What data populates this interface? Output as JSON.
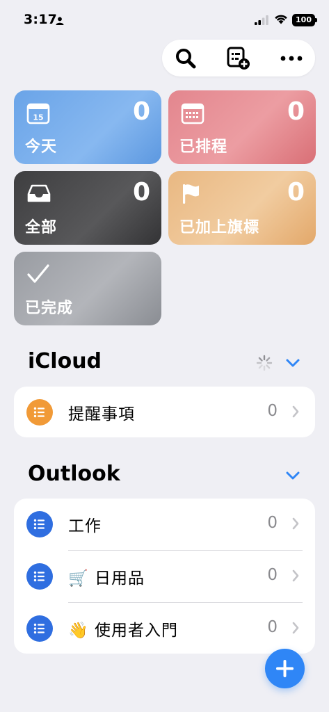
{
  "status_bar": {
    "time": "3:17",
    "battery": "100",
    "icons": [
      "person-icon",
      "signal-icon",
      "wifi-icon",
      "battery-icon"
    ]
  },
  "toolbar": {
    "icons": [
      "search-icon",
      "add-filter-list-icon",
      "more-icon"
    ]
  },
  "smart_lists": [
    {
      "label": "今天",
      "count": "0",
      "icon": "calendar-today-icon",
      "color": "#6aa4e8",
      "icon_text": "15"
    },
    {
      "label": "已排程",
      "count": "0",
      "icon": "calendar-grid-icon",
      "color": "#e3868e"
    },
    {
      "label": "全部",
      "count": "0",
      "icon": "tray-icon",
      "color": "#4a4a4c"
    },
    {
      "label": "已加上旗標",
      "count": "0",
      "icon": "flag-icon",
      "color": "#e9b882"
    },
    {
      "label": "已完成",
      "icon": "checkmark-icon",
      "color": "#a3a5ab"
    }
  ],
  "icloud": {
    "title": "iCloud",
    "lists": [
      {
        "label": "提醒事項",
        "count": "0",
        "color": "#f19a37"
      }
    ]
  },
  "outlook": {
    "title": "Outlook",
    "lists": [
      {
        "label": "工作",
        "count": "0",
        "color": "#2f6ee0"
      },
      {
        "label": "🛒 日用品",
        "count": "0",
        "color": "#2f6ee0"
      },
      {
        "label": "👋 使用者入門",
        "count": "0",
        "color": "#2f6ee0"
      }
    ]
  },
  "colors": {
    "background": "#efeff4",
    "accent": "#2f86f6",
    "chevron": "#2f86f6"
  }
}
